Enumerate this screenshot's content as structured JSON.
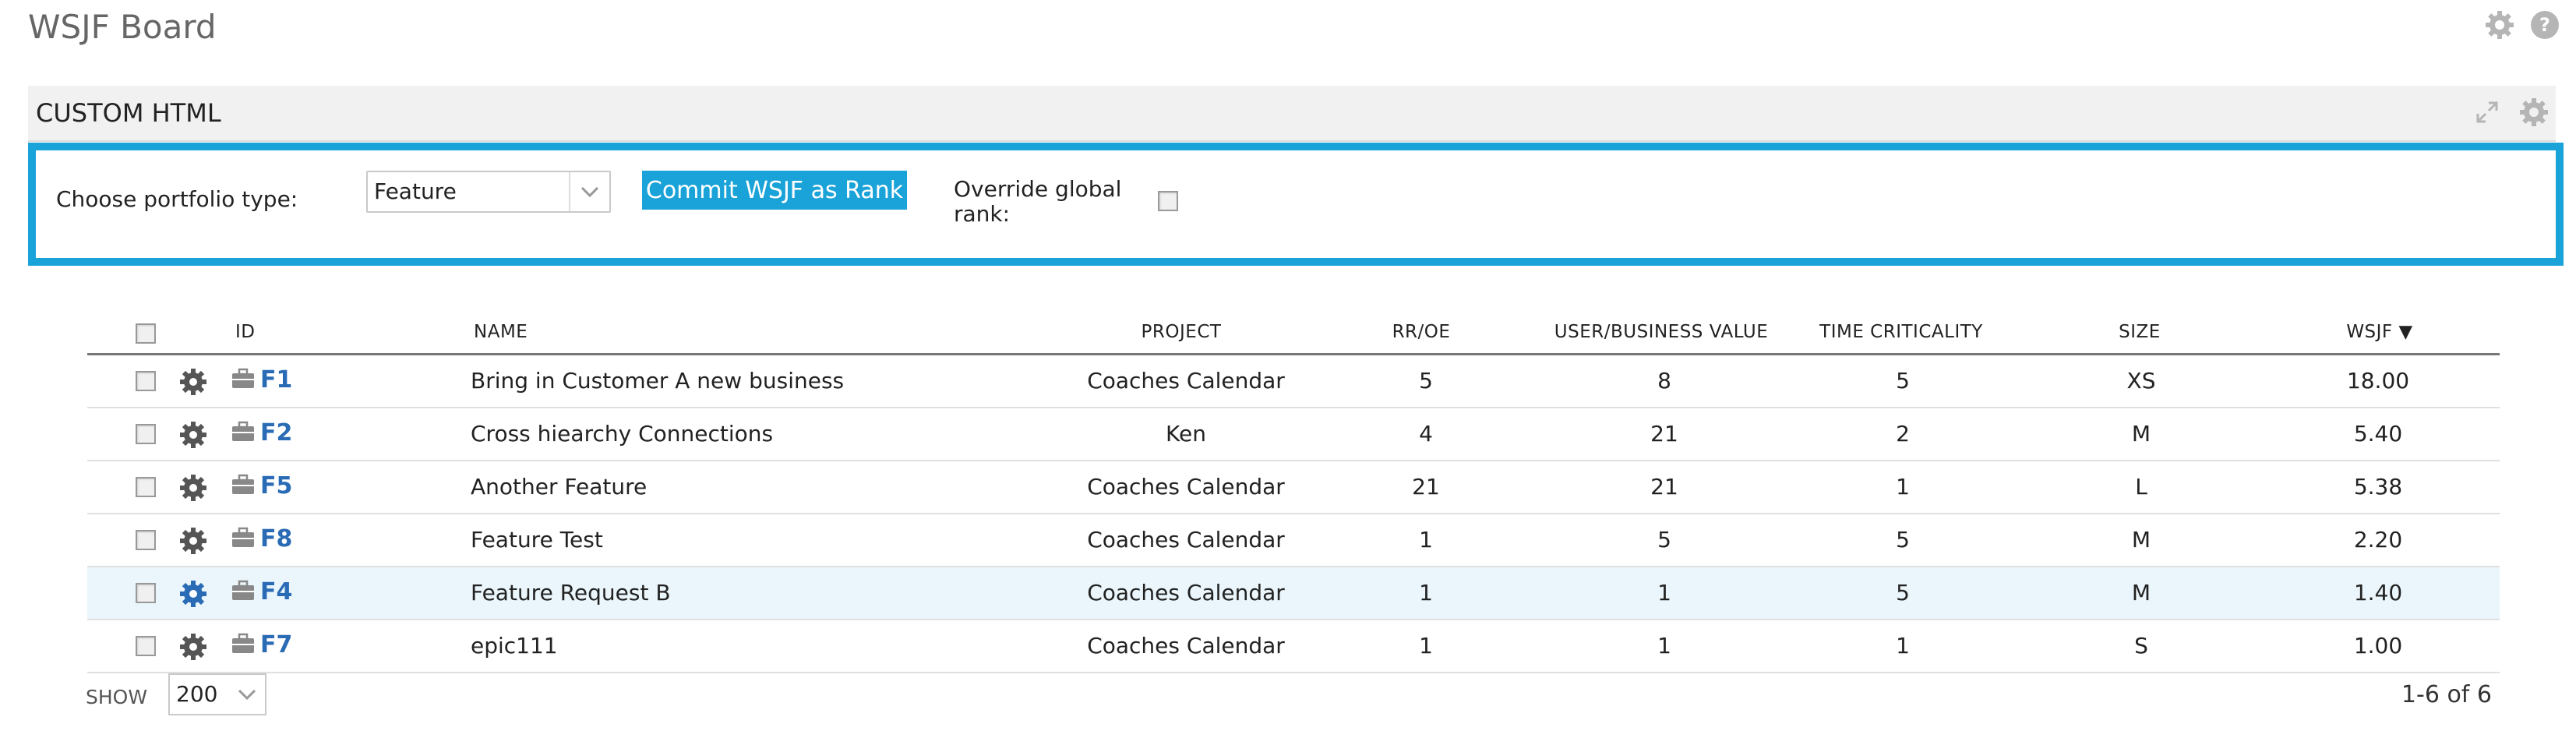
{
  "page": {
    "title": "WSJF Board"
  },
  "top_icons": [
    "gear-icon",
    "help-icon"
  ],
  "panel": {
    "title": "CUSTOM HTML",
    "icons": [
      "expand-icon",
      "gear-icon"
    ]
  },
  "controls": {
    "portfolio_label": "Choose portfolio type:",
    "portfolio_value": "Feature",
    "commit_label": "Commit WSJF as Rank",
    "override_label_line1": "Override global",
    "override_label_line2": "rank:",
    "override_checked": false
  },
  "grid": {
    "columns": {
      "id": "ID",
      "name": "NAME",
      "project": "PROJECT",
      "rroe": "RR/OE",
      "value": "USER/BUSINESS VALUE",
      "time": "TIME CRITICALITY",
      "size": "SIZE",
      "wsjf": "WSJF",
      "sort_indicator": "▼"
    },
    "rows": [
      {
        "id": "F1",
        "name": "Bring in Customer A new business",
        "project": "Coaches Calendar",
        "rroe": "5",
        "value": "8",
        "time": "5",
        "size": "XS",
        "wsjf": "18.00",
        "selected": false
      },
      {
        "id": "F2",
        "name": "Cross hiearchy Connections",
        "project": "Ken",
        "rroe": "4",
        "value": "21",
        "time": "2",
        "size": "M",
        "wsjf": "5.40",
        "selected": false
      },
      {
        "id": "F5",
        "name": "Another Feature",
        "project": "Coaches Calendar",
        "rroe": "21",
        "value": "21",
        "time": "1",
        "size": "L",
        "wsjf": "5.38",
        "selected": false
      },
      {
        "id": "F8",
        "name": "Feature Test",
        "project": "Coaches Calendar",
        "rroe": "1",
        "value": "5",
        "time": "5",
        "size": "M",
        "wsjf": "2.20",
        "selected": false
      },
      {
        "id": "F4",
        "name": "Feature Request B",
        "project": "Coaches Calendar",
        "rroe": "1",
        "value": "1",
        "time": "5",
        "size": "M",
        "wsjf": "1.40",
        "selected": true
      },
      {
        "id": "F7",
        "name": "epic111",
        "project": "Coaches Calendar",
        "rroe": "1",
        "value": "1",
        "time": "1",
        "size": "S",
        "wsjf": "1.00",
        "selected": false
      }
    ]
  },
  "footer": {
    "show_label": "SHOW",
    "page_size": "200",
    "count": "1-6 of 6"
  },
  "colors": {
    "accent": "#1aa3d8",
    "link": "#2a6bb5",
    "selected_row": "#eaf6fb"
  }
}
